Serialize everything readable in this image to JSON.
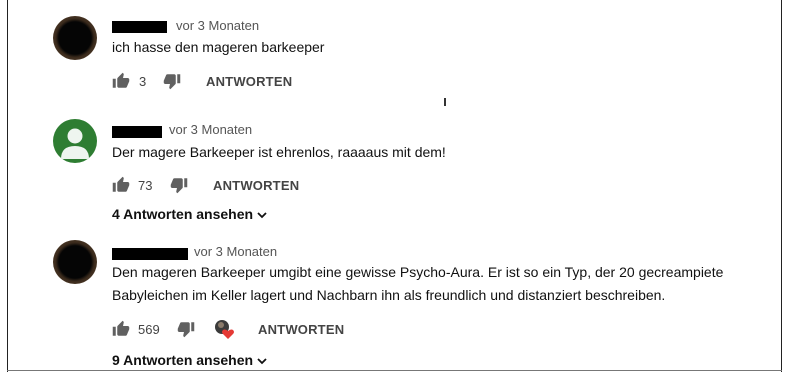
{
  "comments": [
    {
      "time": "vor 3 Monaten",
      "text_lines": [
        "ich hasse den mageren barkeeper"
      ],
      "likes": "3",
      "reply_label": "ANTWORTEN"
    },
    {
      "time": "vor 3 Monaten",
      "text_lines": [
        "Der magere Barkeeper ist ehrenlos, raaaaus mit dem!"
      ],
      "likes": "73",
      "reply_label": "ANTWORTEN",
      "replies_label": "4 Antworten ansehen"
    },
    {
      "time": "vor 3 Monaten",
      "text_lines": [
        "Den mageren Barkeeper umgibt eine gewisse Psycho-Aura. Er ist so ein Typ, der 20 gecreampiete",
        "Babyleichen im Keller lagert und Nachbarn ihn als freundlich und distanziert beschreiben."
      ],
      "likes": "569",
      "reply_label": "ANTWORTEN",
      "replies_label": "9 Antworten ansehen",
      "creator_heart": true
    }
  ],
  "icons": {
    "like": "thumbs-up-icon",
    "dislike": "thumbs-down-icon",
    "expand": "chevron-down-icon",
    "heart": "creator-heart-icon"
  },
  "colors": {
    "default_avatar": "#2e7d32",
    "heart": "#e53935"
  }
}
